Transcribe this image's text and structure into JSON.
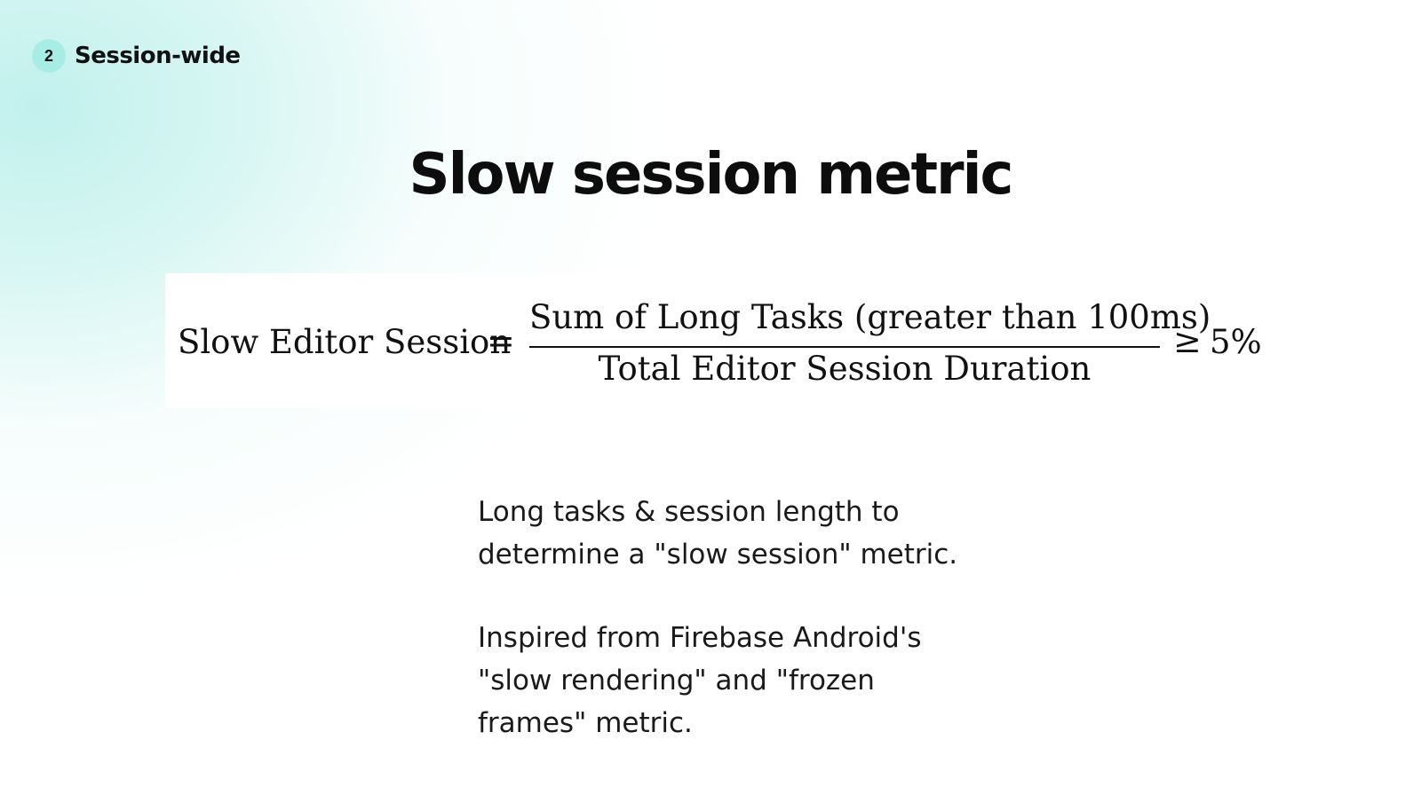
{
  "section": {
    "number": "2",
    "label": "Session-wide"
  },
  "title": "Slow session metric",
  "formula": {
    "lhs": "Slow Editor Session",
    "equals": "=",
    "numerator": "Sum of Long Tasks (greater than 100ms)",
    "denominator": "Total Editor Session Duration",
    "comparator": "≥",
    "threshold": "5%"
  },
  "body": {
    "paragraph1_line1": "Long tasks & session length to",
    "paragraph1_line2": "determine a \"slow session\" metric.",
    "paragraph2_line1": "Inspired from Firebase Android's",
    "paragraph2_line2": "\"slow rendering\" and \"frozen",
    "paragraph2_line3": "frames\" metric."
  },
  "colors": {
    "accent_teal": "#a8ece6",
    "background_glow": "#cdf4f0",
    "text": "#111111"
  }
}
